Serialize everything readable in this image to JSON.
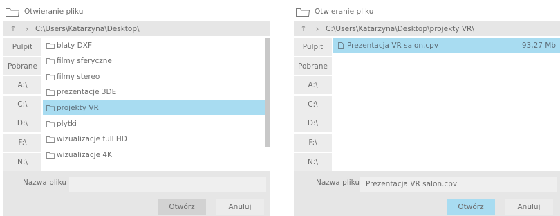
{
  "left": {
    "title": "Otwieranie pliku",
    "path": "C:\\Users\\Katarzyna\\Desktop\\",
    "bookmarks": [
      "Pulpit",
      "Pobrane",
      "A:\\",
      "C:\\",
      "D:\\",
      "F:\\",
      "N:\\"
    ],
    "files": [
      "blaty DXF",
      "filmy sferyczne",
      "filmy stereo",
      "prezentacje 3DE",
      "projekty VR",
      "płytki",
      "wizualizacje full HD",
      "wizualizacje 4K"
    ],
    "selected_index": 4,
    "filename_label": "Nazwa pliku",
    "filename_value": "",
    "open_label": "Otwórz",
    "cancel_label": "Anuluj"
  },
  "right": {
    "title": "Otwieranie pliku",
    "path": "C:\\Users\\Katarzyna\\Desktop\\projekty VR\\",
    "bookmarks": [
      "Pulpit",
      "Pobrane",
      "A:\\",
      "C:\\",
      "D:\\",
      "F:\\",
      "N:\\"
    ],
    "files": [
      {
        "name": "Prezentacja VR salon.cpv",
        "size": "93,27 Mb"
      }
    ],
    "selected_index": 0,
    "filename_label": "Nazwa pliku",
    "filename_value": "Prezentacja VR salon.cpv",
    "open_label": "Otwórz",
    "cancel_label": "Anuluj"
  },
  "colors": {
    "selection": "#a8dcf1",
    "panel": "#e6e6e6",
    "bookmark": "#ececec"
  },
  "icons": {
    "title": "folder-outline-icon",
    "up": "arrow-up-icon",
    "forward": "chevron-right-icon",
    "folder": "folder-icon",
    "file": "file-icon"
  }
}
